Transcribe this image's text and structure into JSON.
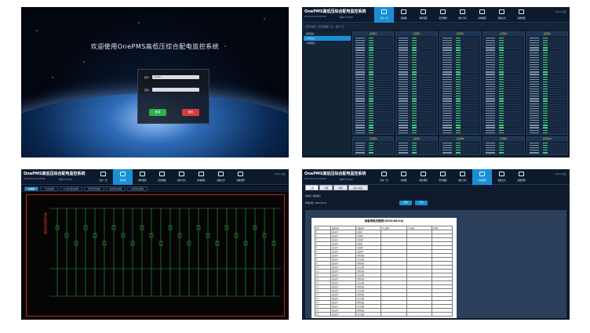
{
  "login": {
    "welcome": "欢迎使用OnePMS高低压综合配电监控系统",
    "user_label": "账号",
    "user_value": "admin",
    "pass_label": "密码",
    "login_btn": "登录",
    "cancel_btn": "退出",
    "color_login": "#2bb24c",
    "color_cancel": "#d83a3a"
  },
  "header": {
    "title": "OnePMS高低压综合配电监控系统",
    "date": "2022-04-15 18:08:46",
    "version": "版本号:V2022",
    "user": "admin 退出",
    "nav": [
      "实时一览",
      "系统图",
      "事件报警",
      "历史数据",
      "统计分析",
      "用电能耗",
      "系统日志",
      "系统管理"
    ]
  },
  "grid": {
    "toolbar": "高压开关柜 > 高压配电柜一览 > 实时一览",
    "left_items": [
      "总配电房",
      "1#配电室",
      "2#配电室"
    ],
    "cards": [
      "高压柜1",
      "高压柜2",
      "高压柜3",
      "高压柜4",
      "高压柜5",
      "高压柜6",
      "高压柜7",
      "高压柜8",
      "高压柜9",
      "高压柜10"
    ]
  },
  "schematic": {
    "tabs": [
      "系统图",
      "一次系统图",
      "2#变压器系统图",
      "低压柜系统图",
      "发电机系统图",
      "直流屏系统图"
    ],
    "title": "高压配电系统图"
  },
  "report": {
    "tabs": [
      "日报",
      "月报",
      "年报",
      "自定义报表"
    ],
    "filter_label": "查询时间: 2022-04-14",
    "filter2": "配电房: 总配电房",
    "btn_query": "查询",
    "btn_export": "导出",
    "report_title": "设备用电日报表(2022/04/14)",
    "columns": [
      "序号",
      "设备名称",
      "回路名称",
      "昨日表码",
      "今日表码",
      "用电量"
    ],
    "rows": [
      [
        "1",
        "高压柜1",
        "进线柜",
        "",
        "",
        ""
      ],
      [
        "2",
        "高压柜1",
        "出线柜1",
        "",
        "",
        ""
      ],
      [
        "3",
        "高压柜1",
        "出线柜2",
        "",
        "",
        ""
      ],
      [
        "4",
        "高压柜2",
        "进线柜",
        "",
        "",
        ""
      ],
      [
        "5",
        "高压柜2",
        "出线柜1",
        "",
        "",
        ""
      ],
      [
        "6",
        "高压柜2",
        "出线柜2",
        "",
        "",
        ""
      ],
      [
        "7",
        "低压柜1",
        "照明回路",
        "",
        "",
        ""
      ],
      [
        "8",
        "低压柜1",
        "动力回路",
        "",
        "",
        ""
      ],
      [
        "9",
        "低压柜2",
        "照明回路",
        "",
        "",
        ""
      ],
      [
        "10",
        "低压柜2",
        "动力回路",
        "",
        "",
        ""
      ],
      [
        "11",
        "低压柜3",
        "照明回路",
        "",
        "",
        ""
      ],
      [
        "12",
        "低压柜3",
        "动力回路",
        "",
        "",
        ""
      ],
      [
        "13",
        "低压柜4",
        "照明回路",
        "",
        "",
        ""
      ],
      [
        "14",
        "低压柜4",
        "动力回路",
        "",
        "",
        ""
      ],
      [
        "15",
        "低压柜5",
        "照明回路",
        "",
        "",
        ""
      ],
      [
        "16",
        "低压柜5",
        "动力回路",
        "",
        "",
        ""
      ],
      [
        "17",
        "低压柜6",
        "照明回路",
        "",
        "",
        ""
      ],
      [
        "18",
        "低压柜6",
        "动力回路",
        "",
        "",
        ""
      ],
      [
        "19",
        "低压柜7",
        "照明回路",
        "",
        "",
        ""
      ],
      [
        "20",
        "低压柜7",
        "动力回路",
        "",
        "",
        ""
      ],
      [
        "21",
        "低压柜8",
        "照明回路",
        "",
        "",
        ""
      ],
      [
        "22",
        "低压柜8",
        "动力回路",
        "",
        "",
        ""
      ]
    ]
  }
}
